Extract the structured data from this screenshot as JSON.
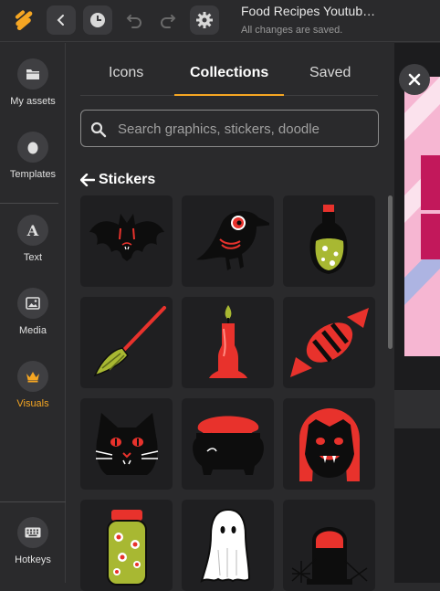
{
  "header": {
    "title": "Food Recipes Youtub…",
    "status": "All changes are saved."
  },
  "sidebar": {
    "items": [
      {
        "label": "My assets",
        "icon": "folder-icon"
      },
      {
        "label": "Templates",
        "icon": "egg-icon"
      },
      {
        "label": "Text",
        "icon": "text-a-icon"
      },
      {
        "label": "Media",
        "icon": "image-icon"
      },
      {
        "label": "Visuals",
        "icon": "crown-icon",
        "active": true
      },
      {
        "label": "Hotkeys",
        "icon": "keyboard-icon"
      }
    ]
  },
  "panel": {
    "tabs": [
      "Icons",
      "Collections",
      "Saved"
    ],
    "active_tab": "Collections",
    "search": {
      "placeholder": "Search graphics, stickers, doodle",
      "value": ""
    },
    "section_title": "Stickers",
    "stickers": [
      "bat-sticker",
      "crow-sticker",
      "potion-bottle-sticker",
      "broom-sticker",
      "candle-sticker",
      "candy-sticker",
      "black-cat-sticker",
      "cauldron-sticker",
      "vampire-sticker",
      "eyeball-jar-sticker",
      "ghost-sticker",
      "tombstone-sticker"
    ]
  },
  "colors": {
    "accent": "#f5a623",
    "background": "#2a2a2c",
    "tile": "#1f1f21",
    "sticker_red": "#e8322c",
    "sticker_green": "#a8b832"
  }
}
